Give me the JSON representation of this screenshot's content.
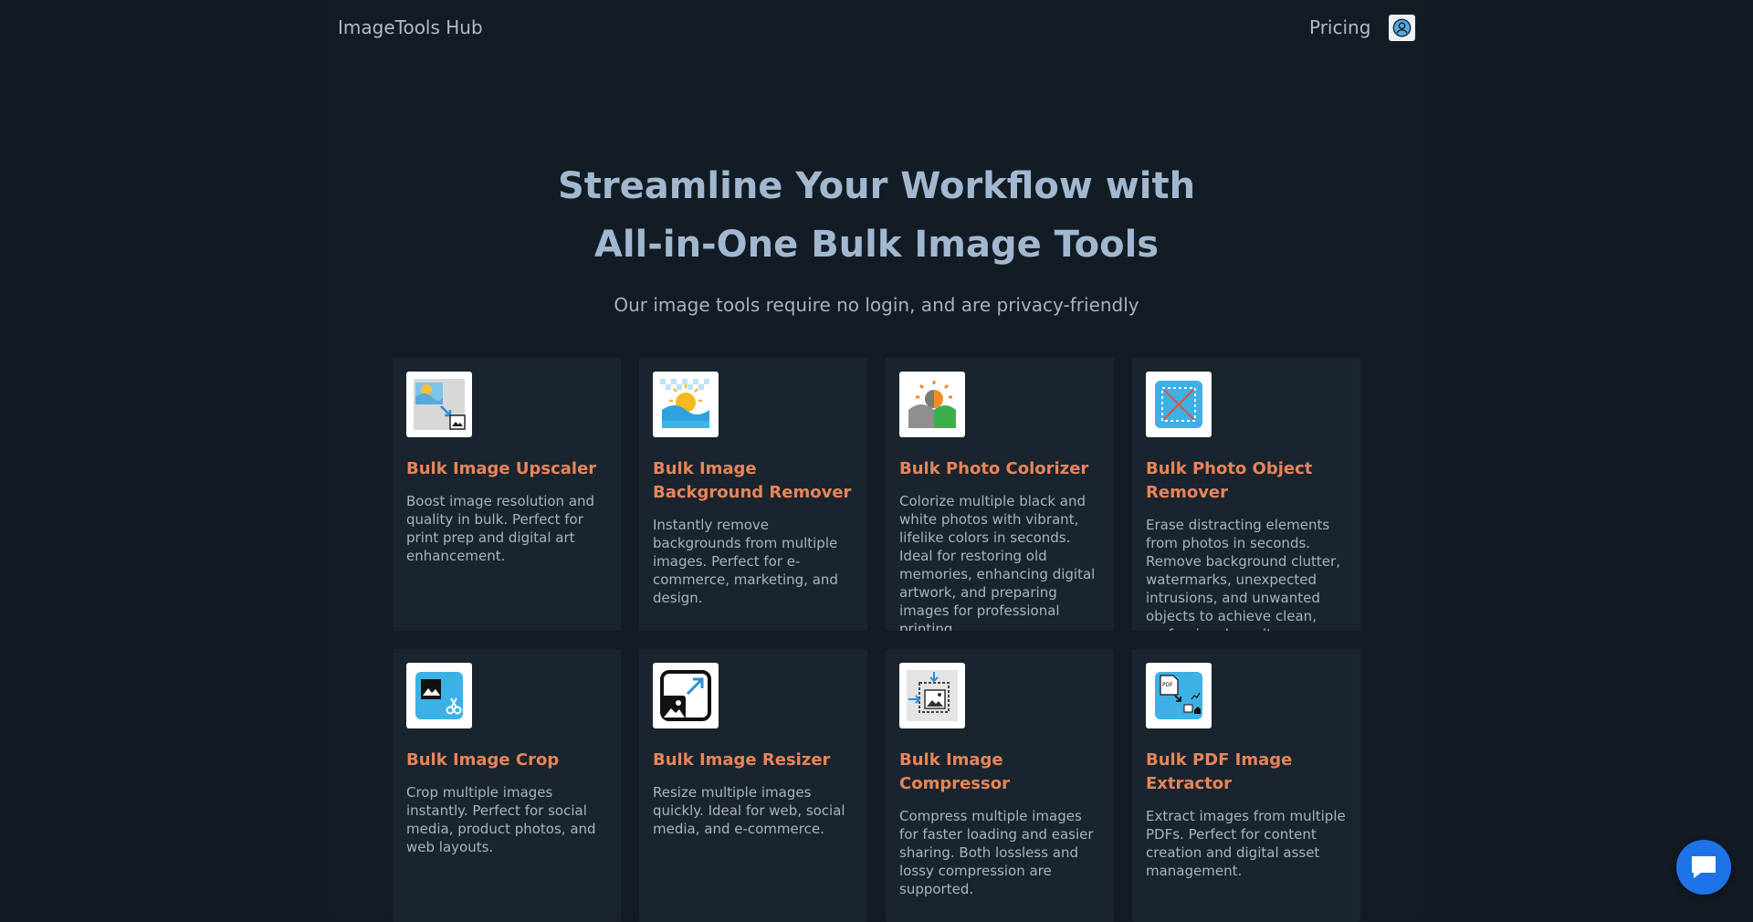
{
  "header": {
    "brand": "ImageTools Hub",
    "pricing_label": "Pricing",
    "account_icon": "user-circle-icon"
  },
  "hero": {
    "title_line1": "Streamline Your Workflow with",
    "title_line2": "All-in-One Bulk Image Tools",
    "subtitle": "Our image tools require no login, and are privacy-friendly"
  },
  "tools": [
    {
      "title": "Bulk Image Upscaler",
      "description": "Boost image resolution and quality in bulk. Perfect for print prep and digital art enhancement.",
      "icon": "upscale-icon"
    },
    {
      "title": "Bulk Image Background Remover",
      "description": "Instantly remove backgrounds from multiple images. Perfect for e-commerce, marketing, and design.",
      "icon": "background-remover-icon"
    },
    {
      "title": "Bulk Photo Colorizer",
      "description": "Colorize multiple black and white photos with vibrant, lifelike colors in seconds. Ideal for restoring old memories, enhancing digital artwork, and preparing images for professional printing.",
      "icon": "colorizer-icon"
    },
    {
      "title": "Bulk Photo Object Remover",
      "description": "Erase distracting elements from photos in seconds. Remove background clutter, watermarks, unexpected intrusions, and unwanted objects to achieve clean, professional results.",
      "icon": "object-remover-icon"
    },
    {
      "title": "Bulk Image Crop",
      "description": "Crop multiple images instantly. Perfect for social media, product photos, and web layouts.",
      "icon": "crop-icon"
    },
    {
      "title": "Bulk Image Resizer",
      "description": "Resize multiple images quickly. Ideal for web, social media, and e-commerce.",
      "icon": "resize-icon"
    },
    {
      "title": "Bulk Image Compressor",
      "description": "Compress multiple images for faster loading and easier sharing. Both lossless and lossy compression are supported.",
      "icon": "compress-icon"
    },
    {
      "title": "Bulk PDF Image Extractor",
      "description": "Extract images from multiple PDFs. Perfect for content creation and digital asset management.",
      "icon": "pdf-extract-icon"
    }
  ],
  "chat": {
    "icon": "chat-bubble-icon"
  },
  "colors": {
    "background": "#121a23",
    "card": "#1a242e",
    "accent": "#e8855a",
    "title": "#a2b8d0",
    "chat": "#1f73e8"
  }
}
